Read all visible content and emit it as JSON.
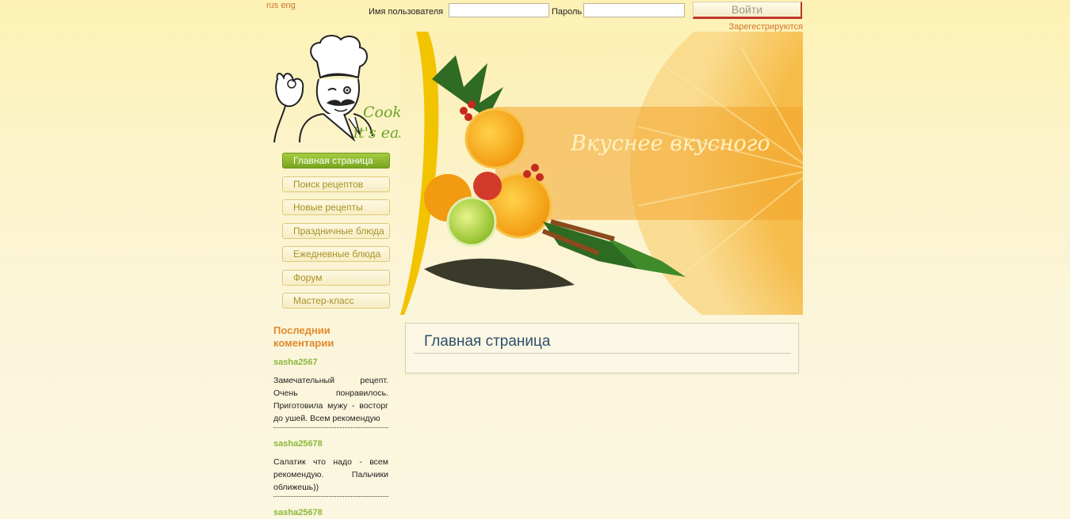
{
  "header": {
    "lang_rus": "rus",
    "lang_eng": "eng",
    "username_label": "Имя пользователя",
    "password_label": "Пароль",
    "login_button": "Войти",
    "register_link": "Зарегестрируются"
  },
  "logo": {
    "line1": "Cooking",
    "line2": "it's easy"
  },
  "banner": {
    "slogan": "Вкуснее вкусного"
  },
  "nav": {
    "items": [
      {
        "label": "Главная страница",
        "active": true
      },
      {
        "label": "Поиск рецептов"
      },
      {
        "label": "Новые рецепты"
      },
      {
        "label": "Праздничные блюда"
      },
      {
        "label": "Ежедневные блюда"
      },
      {
        "label": "Форум"
      },
      {
        "label": "Мастер-класс"
      }
    ]
  },
  "comments": {
    "title": "Последнии коментарии",
    "items": [
      {
        "author": "sasha2567",
        "text": "Замечательный рецепт. Очень понравилось. Приготовила мужу - восторг до ушей. Всем рекомендую"
      },
      {
        "author": "sasha25678",
        "text": "Салатик что надо - всем рекомендую. Пальчики оближешь))"
      },
      {
        "author": "sasha25678"
      }
    ]
  },
  "main": {
    "title": "Главная страница"
  },
  "colors": {
    "accent_green": "#8bb83a",
    "accent_orange": "#e08a2e",
    "nav_text": "#a8912a",
    "title_blue": "#2f4e6e"
  }
}
